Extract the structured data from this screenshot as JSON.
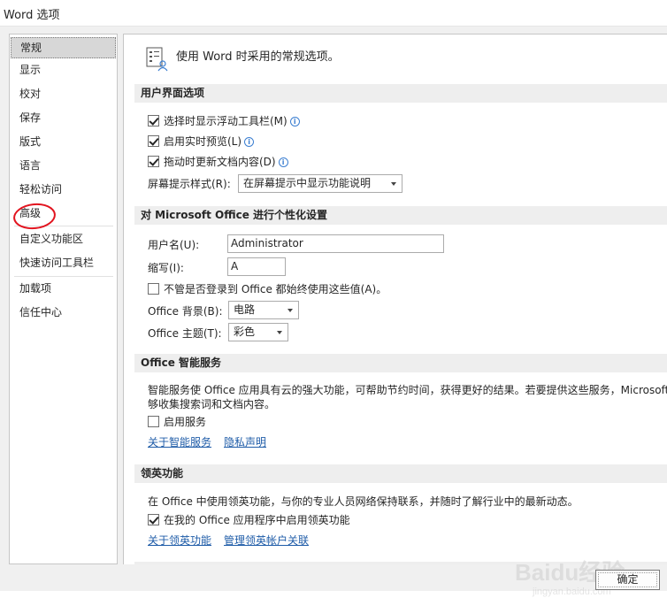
{
  "window": {
    "title": "Word 选项"
  },
  "sidebar": {
    "items": [
      {
        "label": "常规"
      },
      {
        "label": "显示"
      },
      {
        "label": "校对"
      },
      {
        "label": "保存"
      },
      {
        "label": "版式"
      },
      {
        "label": "语言"
      },
      {
        "label": "轻松访问"
      },
      {
        "label": "高级"
      },
      {
        "label": "自定义功能区"
      },
      {
        "label": "快速访问工具栏"
      },
      {
        "label": "加载项"
      },
      {
        "label": "信任中心"
      }
    ],
    "selected": "常规",
    "highlight_color": "#e2141f"
  },
  "content": {
    "intro": "使用 Word 时采用的常规选项。",
    "ui_section": {
      "header": "用户界面选项",
      "opt_mini_toolbar": "选择时显示浮动工具栏(M)",
      "opt_live_preview": "启用实时预览(L)",
      "opt_update_drag": "拖动时更新文档内容(D)",
      "screentip_label": "屏幕提示样式(R):",
      "screentip_value": "在屏幕提示中显示功能说明"
    },
    "personalize_section": {
      "header": "对 Microsoft Office 进行个性化设置",
      "username_label": "用户名(U):",
      "username_value": "Administrator",
      "initials_label": "缩写(I):",
      "initials_value": "A",
      "always_use": "不管是否登录到 Office 都始终使用这些值(A)。",
      "background_label": "Office 背景(B):",
      "background_value": "电路",
      "theme_label": "Office 主题(T):",
      "theme_value": "彩色"
    },
    "intelligent_section": {
      "header": "Office 智能服务",
      "desc_line1": "智能服务使 Office 应用具有云的强大功能，可帮助节约时间，获得更好的结果。若要提供这些服务，Microsoft",
      "desc_line2": "够收集搜索词和文档内容。",
      "enable_services": "启用服务",
      "link_about": "关于智能服务",
      "link_privacy": "隐私声明"
    },
    "linkedin_section": {
      "header": "领英功能",
      "desc": "在 Office 中使用领英功能，与你的专业人员网络保持联系，并随时了解行业中的最新动态。",
      "enable_linkedin": "在我的 Office 应用程序中启用领英功能",
      "link_about": "关于领英功能",
      "link_manage": "管理领英帐户关联"
    }
  },
  "footer": {
    "ok_label": "确定"
  },
  "watermark": {
    "text": "Baidu经验",
    "subtext": "jingyan.baidu.com"
  },
  "colors": {
    "link": "#1f5ca8",
    "info_icon": "#3c7fd1",
    "selected_item": "#d7d7d7"
  }
}
